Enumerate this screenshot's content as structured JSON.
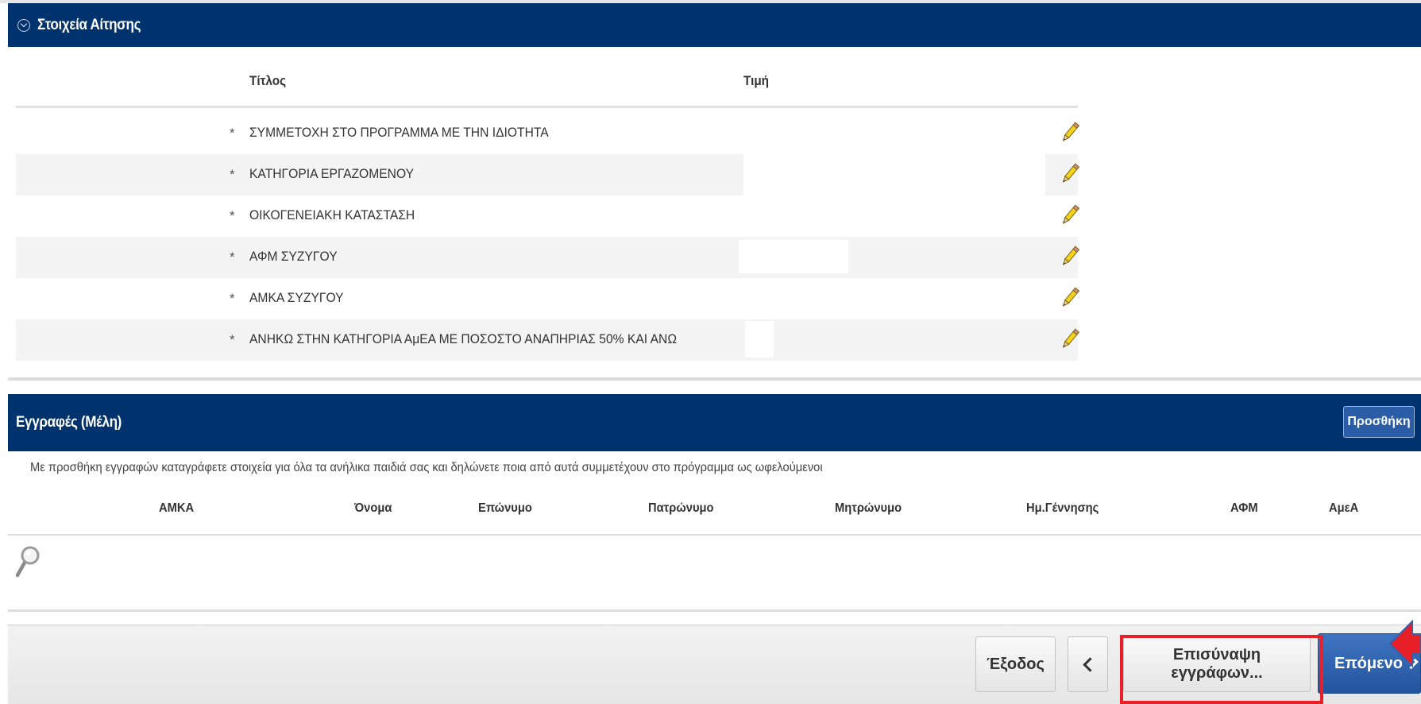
{
  "section1": {
    "title": "Στοιχεία Αίτησης",
    "columns": {
      "title": "Τίτλος",
      "value": "Τιμή"
    },
    "rows": [
      {
        "required": "*",
        "label": "ΣΥΜΜΕΤΟΧΗ ΣΤΟ ΠΡΟΓΡΑΜΜΑ ΜΕ ΤΗΝ ΙΔΙΟΤΗΤΑ",
        "value": ""
      },
      {
        "required": "*",
        "label": "ΚΑΤΗΓΟΡΙΑ ΕΡΓΑΖΟΜΕΝΟΥ",
        "value": ""
      },
      {
        "required": "*",
        "label": "ΟΙΚΟΓΕΝΕΙΑΚΗ ΚΑΤΑΣΤΑΣΗ",
        "value": ""
      },
      {
        "required": "*",
        "label": "ΑΦΜ ΣΥΖΥΓΟΥ",
        "value": ""
      },
      {
        "required": "*",
        "label": "ΑΜΚΑ ΣΥΖΥΓΟΥ",
        "value": ""
      },
      {
        "required": "*",
        "label": "ΑΝΗΚΩ ΣΤΗΝ ΚΑΤΗΓΟΡΙΑ ΑμΕΑ ΜΕ ΠΟΣΟΣΤΟ ΑΝΑΠΗΡΙΑΣ 50% ΚΑΙ ΑΝΩ",
        "value": ""
      }
    ]
  },
  "section2": {
    "title": "Εγγραφές (Μέλη)",
    "add_label": "Προσθήκη",
    "note": "Με προσθήκη εγγραφών καταγράφετε στοιχεία για όλα τα ανήλικα παιδιά σας και δηλώνετε ποια από αυτά συμμετέχουν στο πρόγραμμα ως ωφελούμενοι",
    "columns": [
      "ΑΜΚΑ",
      "Όνομα",
      "Επώνυμο",
      "Πατρώνυμο",
      "Μητρώνυμο",
      "Ημ.Γέννησης",
      "ΑΦΜ",
      "ΑμεΑ"
    ]
  },
  "footer": {
    "exit_label": "Έξοδος",
    "attach_label": "Επισύναψη εγγράφων...",
    "next_label": "Επόμενο"
  },
  "colors": {
    "header_bg": "#00326e",
    "primary_button": "#2a5da6",
    "highlight": "#e8202a"
  }
}
